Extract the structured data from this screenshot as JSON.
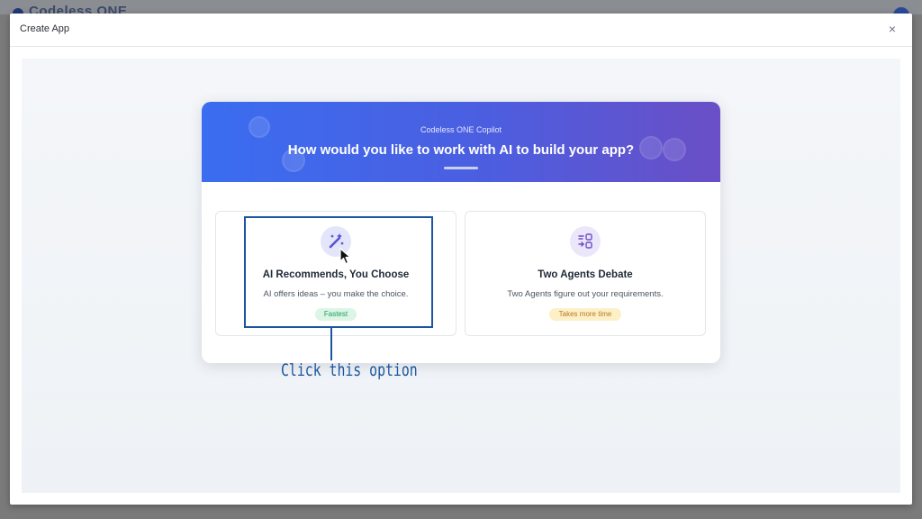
{
  "backdrop": {
    "brand": "Codeless ONE"
  },
  "modal": {
    "title": "Create App",
    "close_label": "×"
  },
  "hero": {
    "subtitle": "Codeless ONE Copilot",
    "title": "How would you like to work with AI to build your app?"
  },
  "options": [
    {
      "icon": "magic-wand-icon",
      "title": "AI Recommends, You Choose",
      "description": "AI offers ideas – you make the choice.",
      "badge": "Fastest",
      "badge_color": "#1f9d55",
      "badge_bg": "#dcf5e6"
    },
    {
      "icon": "debate-agents-icon",
      "title": "Two Agents Debate",
      "description": "Two Agents figure out your requirements.",
      "badge": "Takes more time",
      "badge_color": "#b7791f",
      "badge_bg": "#fdf0c7"
    }
  ],
  "annotation": {
    "callout_text": "Click this option",
    "color": "#1a56a0"
  },
  "colors": {
    "hero_start": "#3a6df0",
    "hero_end": "#6a4fc6",
    "icon_bg": "#e6e8fb",
    "icon_fg": "#5b4fd6"
  }
}
